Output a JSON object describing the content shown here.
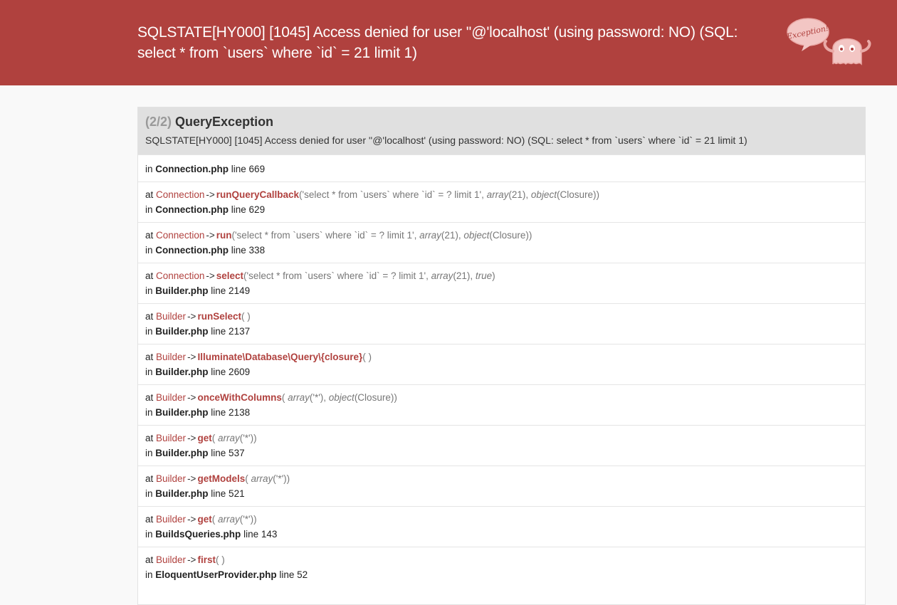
{
  "header": {
    "title": "SQLSTATE[HY000] [1045] Access denied for user ''@'localhost' (using password: NO) (SQL: select * from `users` where `id` = 21 limit 1)",
    "logo_text": "Exception!"
  },
  "exception": {
    "count": "(2/2)",
    "name": "QueryException",
    "message": "SQLSTATE[HY000] [1045] Access denied for user ''@'localhost' (using password: NO) (SQL: select * from `users` where `id` = 21 limit 1)"
  },
  "first_frame": {
    "in": "in",
    "file": "Connection.php",
    "line": "line 669"
  },
  "frames": [
    {
      "cls": "Connection",
      "fn": "runQueryCallback",
      "a1": "'select * from `users` where `id` = ? limit 1', ",
      "k1": "array",
      "a2": "(21), ",
      "k2": "object",
      "a3": "(Closure))",
      "file": "Connection.php",
      "line": "line 629"
    },
    {
      "cls": "Connection",
      "fn": "run",
      "a1": "'select * from `users` where `id` = ? limit 1', ",
      "k1": "array",
      "a2": "(21), ",
      "k2": "object",
      "a3": "(Closure))",
      "file": "Connection.php",
      "line": "line 338"
    },
    {
      "cls": "Connection",
      "fn": "select",
      "a1": "'select * from `users` where `id` = ? limit 1', ",
      "k1": "array",
      "a2": "(21), ",
      "k2": "true",
      "a3": ")",
      "file": "Builder.php",
      "line": "line 2149"
    },
    {
      "cls": "Builder",
      "fn": "runSelect",
      "a1": " )",
      "k1": "",
      "a2": "",
      "k2": "",
      "a3": "",
      "file": "Builder.php",
      "line": "line 2137"
    },
    {
      "cls": "Builder",
      "fn": "Illuminate\\Database\\Query\\{closure}",
      "a1": " )",
      "k1": "",
      "a2": "",
      "k2": "",
      "a3": "",
      "file": "Builder.php",
      "line": "line 2609"
    },
    {
      "cls": "Builder",
      "fn": "onceWithColumns",
      "a1": " ",
      "k1": "array",
      "a2": "('*'), ",
      "k2": "object",
      "a3": "(Closure))",
      "file": "Builder.php",
      "line": "line 2138"
    },
    {
      "cls": "Builder",
      "fn": "get",
      "a1": " ",
      "k1": "array",
      "a2": "('*'))",
      "k2": "",
      "a3": "",
      "file": "Builder.php",
      "line": "line 537"
    },
    {
      "cls": "Builder",
      "fn": "getModels",
      "a1": " ",
      "k1": "array",
      "a2": "('*'))",
      "k2": "",
      "a3": "",
      "file": "Builder.php",
      "line": "line 521"
    },
    {
      "cls": "Builder",
      "fn": "get",
      "a1": " ",
      "k1": "array",
      "a2": "('*'))",
      "k2": "",
      "a3": "",
      "file": "BuildsQueries.php",
      "line": "line 143"
    },
    {
      "cls": "Builder",
      "fn": "first",
      "a1": " )",
      "k1": "",
      "a2": "",
      "k2": "",
      "a3": "",
      "file": "EloquentUserProvider.php",
      "line": "line 52"
    }
  ],
  "labels": {
    "at": "at",
    "arrow": "->",
    "in": "in",
    "paren_open": "("
  }
}
